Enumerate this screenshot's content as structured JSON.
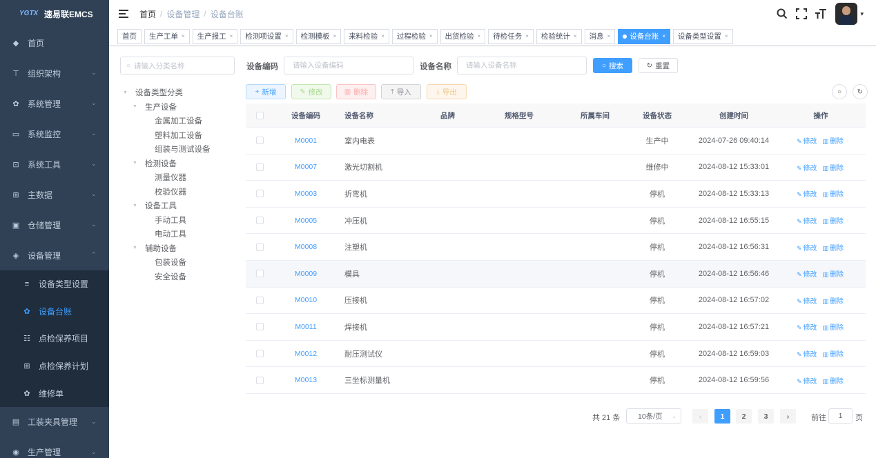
{
  "app": {
    "logo_mark": "YGTX",
    "name": "速易联EMCS"
  },
  "sidebar": {
    "items": [
      {
        "label": "首页",
        "icon": "dashboard-icon",
        "glyph": "◆"
      },
      {
        "label": "组织架构",
        "icon": "org-tree-icon",
        "glyph": "⊤",
        "arrow": "⌄"
      },
      {
        "label": "系统管理",
        "icon": "gear-icon",
        "glyph": "✿",
        "arrow": "⌄"
      },
      {
        "label": "系统监控",
        "icon": "monitor-icon",
        "glyph": "▭",
        "arrow": "⌄"
      },
      {
        "label": "系统工具",
        "icon": "toolbox-icon",
        "glyph": "⊡",
        "arrow": "⌄"
      },
      {
        "label": "主数据",
        "icon": "grid-icon",
        "glyph": "⊞",
        "arrow": "⌄"
      },
      {
        "label": "仓储管理",
        "icon": "warehouse-icon",
        "glyph": "▣",
        "arrow": "⌄"
      },
      {
        "label": "设备管理",
        "icon": "layers-icon",
        "glyph": "◈",
        "arrow": "⌃"
      }
    ],
    "submenu": [
      {
        "label": "设备类型设置",
        "icon": "sliders-icon",
        "glyph": "≡"
      },
      {
        "label": "设备台账",
        "icon": "gear-icon",
        "glyph": "✿",
        "active": true
      },
      {
        "label": "点检保养项目",
        "icon": "checklist-icon",
        "glyph": "☷"
      },
      {
        "label": "点检保养计划",
        "icon": "calendar-icon",
        "glyph": "⊞"
      },
      {
        "label": "维修单",
        "icon": "gear-icon",
        "glyph": "✿"
      }
    ],
    "after": [
      {
        "label": "工装夹具管理",
        "icon": "lock-icon",
        "glyph": "▤",
        "arrow": "⌄"
      },
      {
        "label": "生产管理",
        "icon": "eye-icon",
        "glyph": "◉",
        "arrow": "⌄"
      }
    ]
  },
  "header": {
    "breadcrumb": [
      "首页",
      "设备管理",
      "设备台账"
    ],
    "separator": "/",
    "icons": [
      "search-icon",
      "fullscreen-icon",
      "font-size-icon"
    ]
  },
  "tags": [
    {
      "label": "首页",
      "closable": false
    },
    {
      "label": "生产工单",
      "closable": true
    },
    {
      "label": "生产报工",
      "closable": true
    },
    {
      "label": "检测项设置",
      "closable": true
    },
    {
      "label": "检测模板",
      "closable": true
    },
    {
      "label": "来料检验",
      "closable": true
    },
    {
      "label": "过程检验",
      "closable": true
    },
    {
      "label": "出货检验",
      "closable": true
    },
    {
      "label": "待检任务",
      "closable": true
    },
    {
      "label": "检验统计",
      "closable": true
    },
    {
      "label": "消息",
      "closable": true
    },
    {
      "label": "设备台账",
      "closable": true,
      "active": true
    },
    {
      "label": "设备类型设置",
      "closable": true
    }
  ],
  "tree": {
    "search_placeholder": "请输入分类名称",
    "nodes": [
      {
        "label": "设备类型分类",
        "level": 0,
        "expanded": true
      },
      {
        "label": "生产设备",
        "level": 1,
        "expanded": true
      },
      {
        "label": "金属加工设备",
        "level": 2
      },
      {
        "label": "塑料加工设备",
        "level": 2
      },
      {
        "label": "组装与测试设备",
        "level": 2
      },
      {
        "label": "检测设备",
        "level": 1,
        "expanded": true
      },
      {
        "label": "测量仪器",
        "level": 2
      },
      {
        "label": "校验仪器",
        "level": 2
      },
      {
        "label": "设备工具",
        "level": 1,
        "expanded": true
      },
      {
        "label": "手动工具",
        "level": 2
      },
      {
        "label": "电动工具",
        "level": 2
      },
      {
        "label": "辅助设备",
        "level": 1,
        "expanded": true
      },
      {
        "label": "包装设备",
        "level": 2
      },
      {
        "label": "安全设备",
        "level": 2
      }
    ]
  },
  "search": {
    "code_label": "设备编码",
    "code_placeholder": "请输入设备编码",
    "name_label": "设备名称",
    "name_placeholder": "请输入设备名称",
    "search_button": "搜索",
    "reset_button": "重置"
  },
  "toolbar": {
    "add": "新增",
    "edit": "修改",
    "delete": "删除",
    "import": "导入",
    "export": "导出"
  },
  "table": {
    "columns": [
      "设备编码",
      "设备名称",
      "品牌",
      "规格型号",
      "所属车间",
      "设备状态",
      "创建时间",
      "操作"
    ],
    "rows": [
      {
        "code": "M0001",
        "name": "室内电表",
        "brand": "",
        "spec": "",
        "workshop": "",
        "status": "生产中",
        "created": "2024-07-26 09:40:14"
      },
      {
        "code": "M0007",
        "name": "激光切割机",
        "brand": "",
        "spec": "",
        "workshop": "",
        "status": "维修中",
        "created": "2024-08-12 15:33:01"
      },
      {
        "code": "M0003",
        "name": "折弯机",
        "brand": "",
        "spec": "",
        "workshop": "",
        "status": "停机",
        "created": "2024-08-12 15:33:13"
      },
      {
        "code": "M0005",
        "name": "冲压机",
        "brand": "",
        "spec": "",
        "workshop": "",
        "status": "停机",
        "created": "2024-08-12 16:55:15"
      },
      {
        "code": "M0008",
        "name": "注塑机",
        "brand": "",
        "spec": "",
        "workshop": "",
        "status": "停机",
        "created": "2024-08-12 16:56:31"
      },
      {
        "code": "M0009",
        "name": "模具",
        "brand": "",
        "spec": "",
        "workshop": "",
        "status": "停机",
        "created": "2024-08-12 16:56:46",
        "hover": true
      },
      {
        "code": "M0010",
        "name": "压接机",
        "brand": "",
        "spec": "",
        "workshop": "",
        "status": "停机",
        "created": "2024-08-12 16:57:02"
      },
      {
        "code": "M0011",
        "name": "焊接机",
        "brand": "",
        "spec": "",
        "workshop": "",
        "status": "停机",
        "created": "2024-08-12 16:57:21"
      },
      {
        "code": "M0012",
        "name": "耐压测试仪",
        "brand": "",
        "spec": "",
        "workshop": "",
        "status": "停机",
        "created": "2024-08-12 16:59:03"
      },
      {
        "code": "M0013",
        "name": "三坐标测量机",
        "brand": "",
        "spec": "",
        "workshop": "",
        "status": "停机",
        "created": "2024-08-12 16:59:56"
      }
    ],
    "op_edit": "修改",
    "op_delete": "删除"
  },
  "pagination": {
    "total": "共 21 条",
    "page_size": "10条/页",
    "pages": [
      "1",
      "2",
      "3"
    ],
    "current": "1",
    "goto_label": "前往",
    "goto_value": "1",
    "page_suffix": "页"
  }
}
